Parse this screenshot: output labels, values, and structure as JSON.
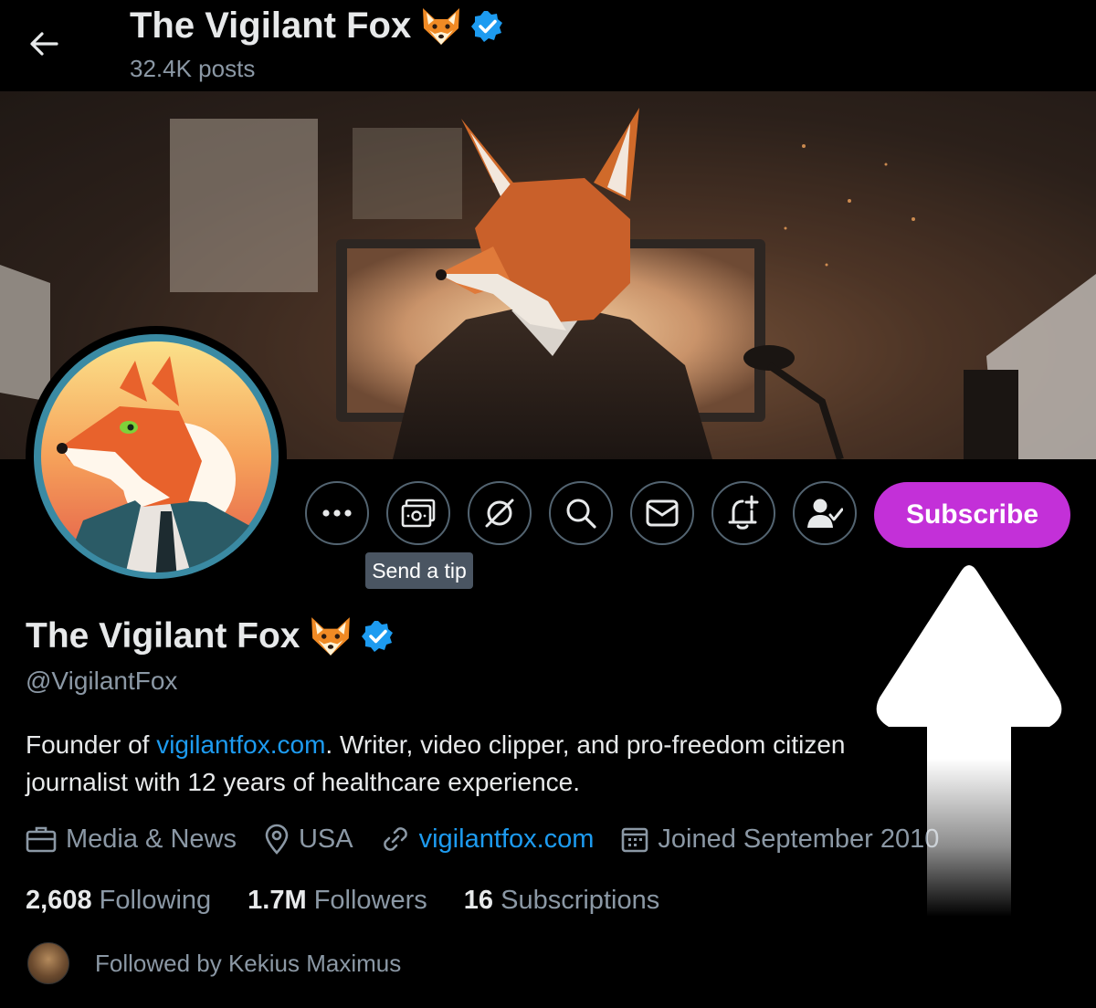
{
  "header": {
    "back_icon": "arrow-left-icon",
    "name": "The Vigilant Fox",
    "posts": "32.4K posts"
  },
  "banner": {
    "description_icon": "fox-at-computer-illustration"
  },
  "actions": {
    "buttons": [
      {
        "icon": "more-icon"
      },
      {
        "icon": "tip-money-icon"
      },
      {
        "icon": "grok-icon"
      },
      {
        "icon": "search-icon"
      },
      {
        "icon": "mail-icon"
      },
      {
        "icon": "bell-plus-icon"
      },
      {
        "icon": "following-user-icon"
      }
    ],
    "tooltip": "Send a tip",
    "subscribe_label": "Subscribe",
    "subscribe_color": "#c330d8"
  },
  "profile": {
    "name": "The Vigilant Fox",
    "handle": "@VigilantFox",
    "bio_prefix": "Founder of ",
    "bio_link": "vigilantfox.com",
    "bio_suffix": ". Writer, video clipper, and pro-freedom citizen journalist with 12 years of healthcare experience.",
    "category": "Media & News",
    "location": "USA",
    "website": "vigilantfox.com",
    "joined": "Joined September 2010",
    "following_count": "2,608",
    "following_label": "Following",
    "followers_count": "1.7M",
    "followers_label": "Followers",
    "subscriptions_count": "16",
    "subscriptions_label": "Subscriptions",
    "followed_by": "Followed by Kekius Maximus"
  },
  "colors": {
    "accent": "#1d9bf0",
    "muted": "#8b98a5",
    "verified": "#1d9bf0"
  }
}
